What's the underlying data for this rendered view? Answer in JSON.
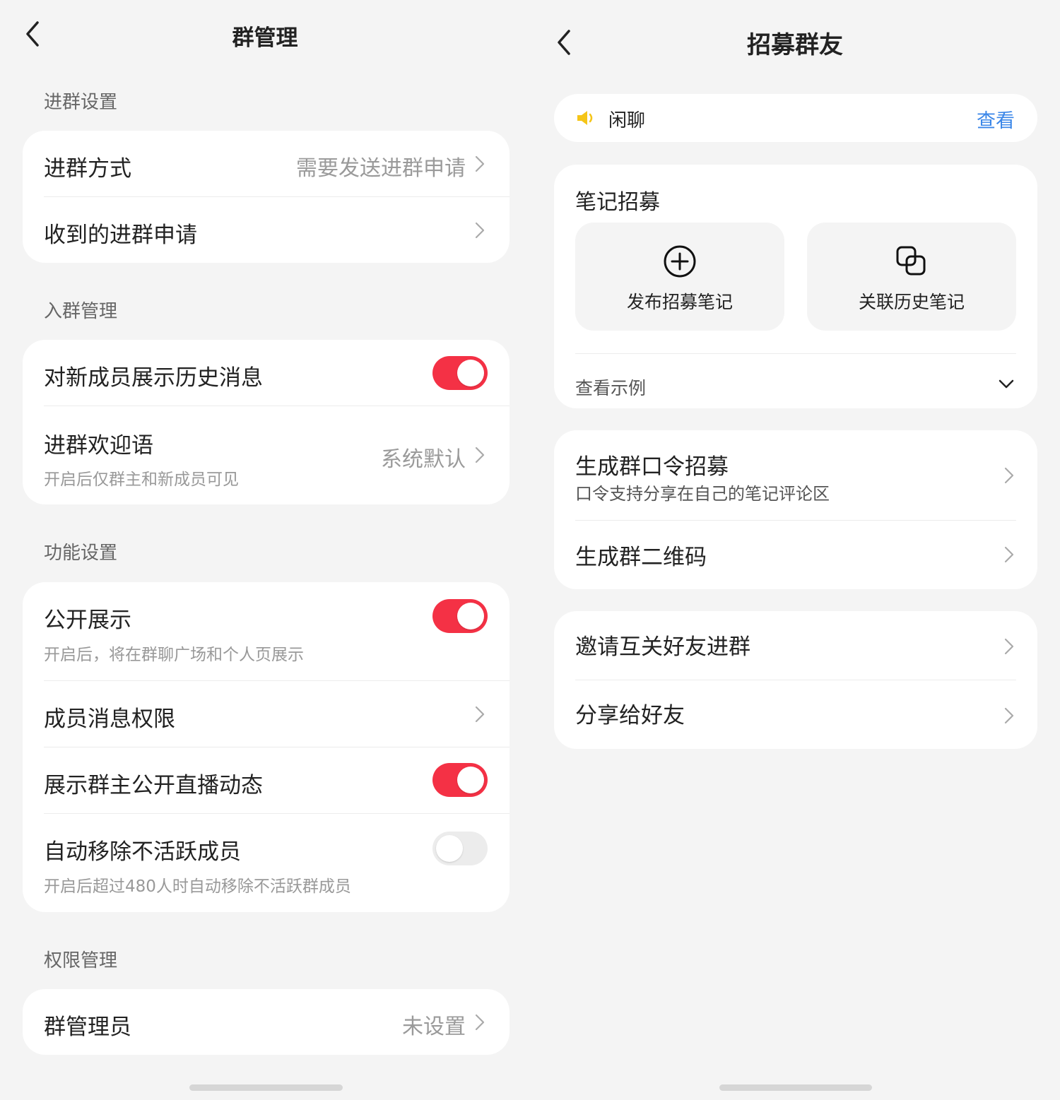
{
  "left": {
    "title": "群管理",
    "sections": {
      "join": {
        "label": "进群设置",
        "join_method": {
          "title": "进群方式",
          "value": "需要发送进群申请"
        },
        "requests": {
          "title": "收到的进群申请"
        }
      },
      "entry": {
        "label": "入群管理",
        "show_history": {
          "title": "对新成员展示历史消息",
          "on": true
        },
        "welcome": {
          "title": "进群欢迎语",
          "subtitle": "开启后仅群主和新成员可见",
          "value": "系统默认"
        }
      },
      "features": {
        "label": "功能设置",
        "public_display": {
          "title": "公开展示",
          "subtitle": "开启后，将在群聊广场和个人页展示",
          "on": true
        },
        "member_permission": {
          "title": "成员消息权限"
        },
        "live_display": {
          "title": "展示群主公开直播动态",
          "on": true
        },
        "auto_remove": {
          "title": "自动移除不活跃成员",
          "subtitle": "开启后超过480人时自动移除不活跃群成员",
          "on": false
        }
      },
      "permissions": {
        "label": "权限管理",
        "admins": {
          "title": "群管理员",
          "value": "未设置"
        }
      }
    }
  },
  "right": {
    "title": "招募群友",
    "notice": {
      "icon": "speaker-icon",
      "text": "闲聊",
      "action": "查看"
    },
    "notes": {
      "heading": "笔记招募",
      "publish": {
        "icon": "plus-circle-icon",
        "label": "发布招募笔记"
      },
      "link_history": {
        "icon": "copy-icon",
        "label": "关联历史笔记"
      },
      "examples": {
        "label": "查看示例"
      }
    },
    "password": {
      "title": "生成群口令招募",
      "subtitle": "口令支持分享在自己的笔记评论区"
    },
    "qrcode": {
      "title": "生成群二维码"
    },
    "invite": {
      "title": "邀请互关好友进群"
    },
    "share": {
      "title": "分享给好友"
    }
  },
  "colors": {
    "accent_red": "#f43145",
    "link_blue": "#3a86e8",
    "speaker_yellow": "#f5c518",
    "background": "#f4f4f4"
  }
}
